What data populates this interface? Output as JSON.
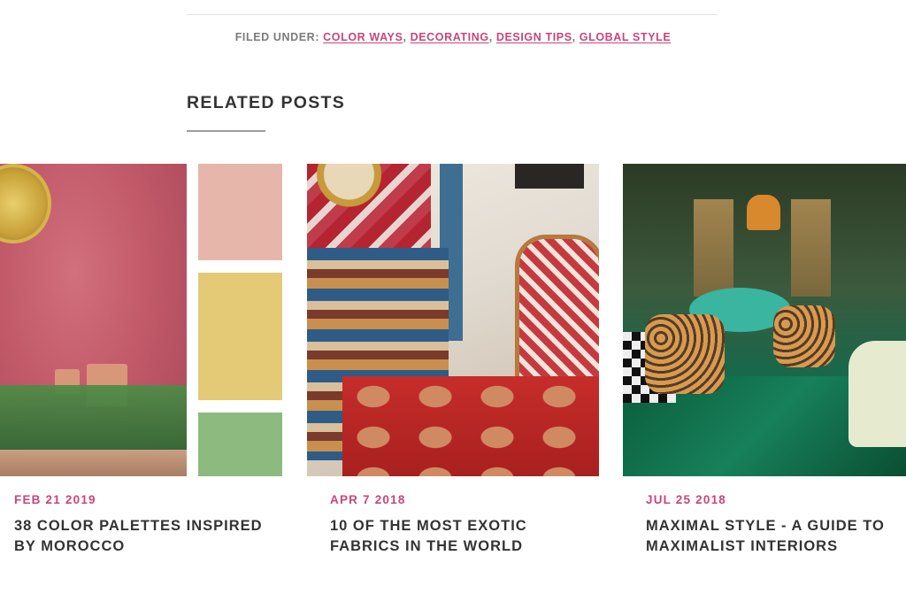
{
  "filed_under": {
    "label": "FILED UNDER:",
    "categories": [
      "COLOR WAYS",
      "DECORATING",
      "DESIGN TIPS",
      "GLOBAL STYLE"
    ]
  },
  "related": {
    "heading": "RELATED POSTS",
    "posts": [
      {
        "date": "FEB 21 2019",
        "title": "38 COLOR PALETTES INSPIRED BY MOROCCO",
        "swatches": [
          "#e7b6ab",
          "#e4c977",
          "#8cba7f"
        ]
      },
      {
        "date": "APR 7 2018",
        "title": "10 OF THE MOST EXOTIC FABRICS IN THE WORLD"
      },
      {
        "date": "JUL 25 2018",
        "title": "MAXIMAL STYLE - A GUIDE TO MAXIMALIST INTERIORS"
      }
    ]
  },
  "colors": {
    "accent": "#c8467b",
    "text": "#333333",
    "muted": "#7b7b7b"
  }
}
